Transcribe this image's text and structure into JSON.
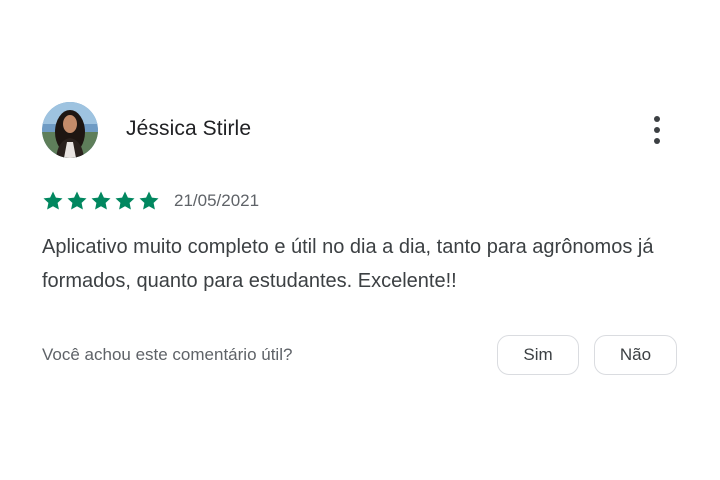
{
  "review": {
    "author": "Jéssica Stirle",
    "rating": 5,
    "rating_max": 5,
    "star_color": "#01875f",
    "date": "21/05/2021",
    "text": "Aplicativo muito completo e útil no dia a dia, tanto para agrônomos já formados, quanto para estudantes. Excelente!!"
  },
  "helpful": {
    "question": "Você achou este comentário útil?",
    "yes_label": "Sim",
    "no_label": "Não"
  },
  "icons": {
    "more": "more-vert-icon",
    "star": "star-icon"
  }
}
